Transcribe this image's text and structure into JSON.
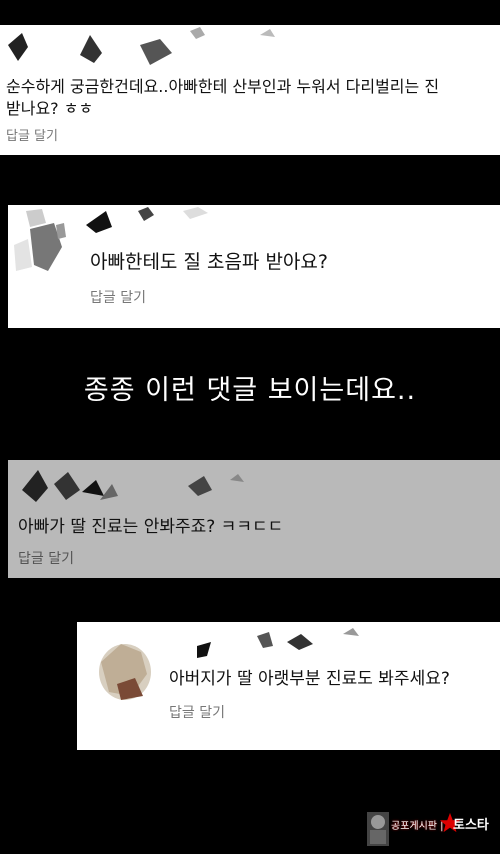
{
  "comments": [
    {
      "line1": "순수하게 궁금한건데요..아빠한테 산부인과 누워서 다리벌리는 진",
      "line2": "받나요? ㅎㅎ",
      "reply_label": "답글 달기"
    },
    {
      "text": "아빠한테도 질 초음파 받아요?",
      "reply_label": "답글 달기"
    },
    {
      "text": "아빠가 딸 진료는 안봐주죠? ㅋㅋㄷㄷ",
      "reply_label": "답글 달기"
    },
    {
      "text": "아버지가 딸 아랫부분 진료도 봐주세요?",
      "reply_label": "답글 달기"
    }
  ],
  "caption": "종종 이런 댓글 보이는데요..",
  "watermark": {
    "text": "공포게시판 | 닥",
    "brand": "토스타"
  },
  "colors": {
    "background": "#000000",
    "card": "#ffffff",
    "card_dimmed": "#b9b9b9",
    "reply": "#777777",
    "watermark_accent": "#cc0000"
  }
}
